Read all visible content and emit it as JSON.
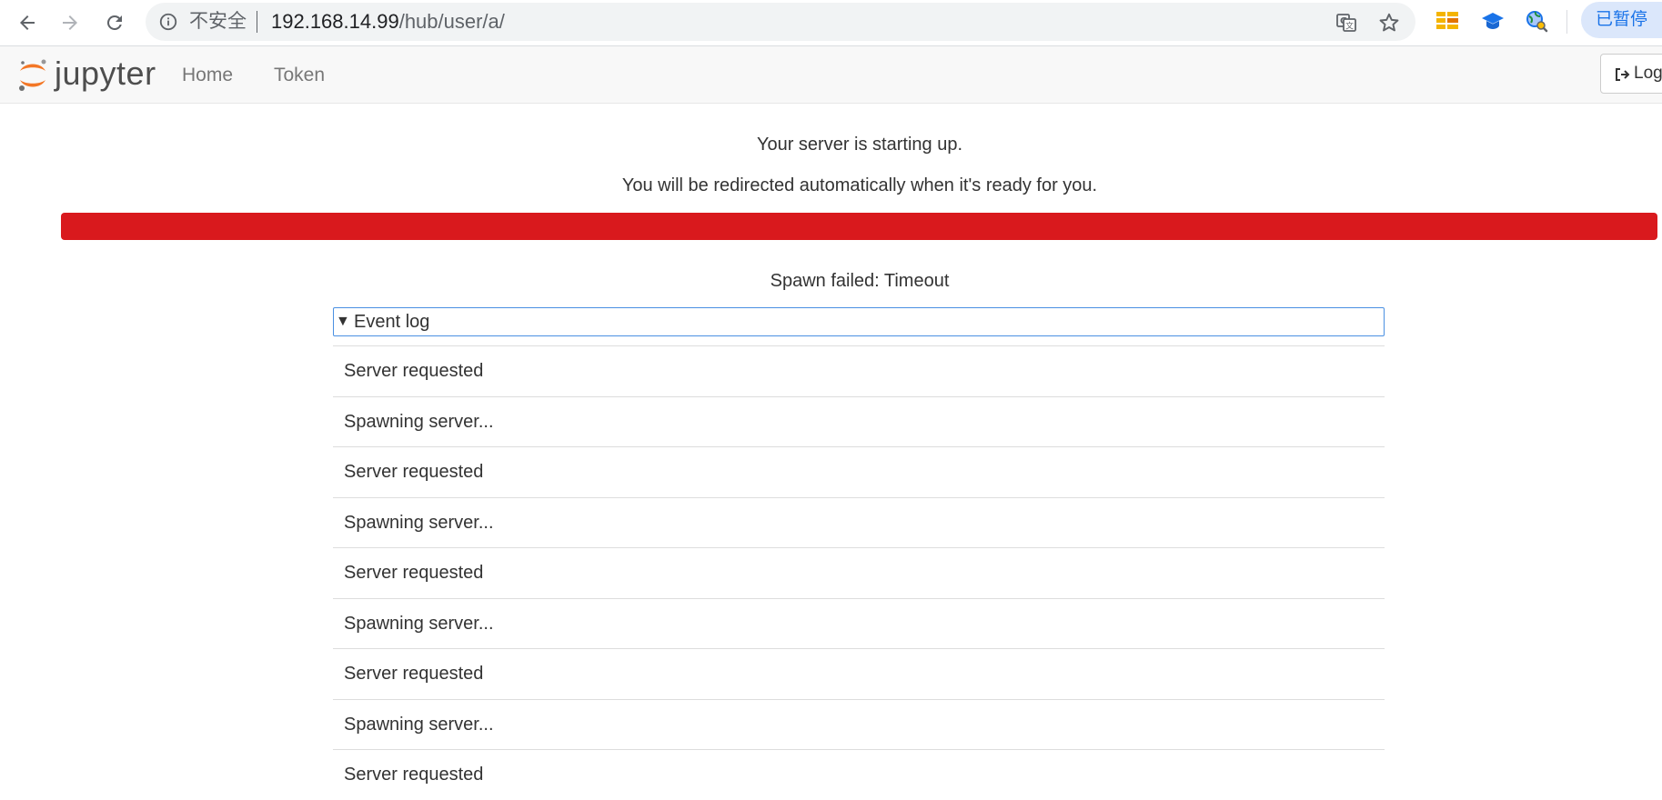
{
  "browser": {
    "insecure_label": "不安全",
    "url_host": "192.168.14.99",
    "url_path": "/hub/user/a/",
    "paused_label": "已暂停"
  },
  "header": {
    "logo_text": "jupyter",
    "nav_home": "Home",
    "nav_token": "Token",
    "logout_label": "Log"
  },
  "main": {
    "starting_message": "Your server is starting up.",
    "redirect_message": "You will be redirected automatically when it's ready for you.",
    "progress": {
      "percent": 100,
      "color": "#d9191d"
    },
    "status_message": "Spawn failed: Timeout",
    "event_log": {
      "summary_label": "Event log",
      "entries": [
        "Server requested",
        "Spawning server...",
        "Server requested",
        "Spawning server...",
        "Server requested",
        "Spawning server...",
        "Server requested",
        "Spawning server...",
        "Server requested"
      ]
    }
  },
  "icons": {
    "back": "back-arrow-icon",
    "forward": "forward-arrow-icon",
    "reload": "reload-icon",
    "info": "info-icon",
    "translate": "translate-icon",
    "bookmark": "star-icon",
    "logout": "sign-out-icon"
  },
  "colors": {
    "accent_blue": "#1a73e8",
    "jupyter_orange": "#f37726",
    "progress_danger": "#d9191d",
    "summary_focus_border": "#4a90e2"
  }
}
